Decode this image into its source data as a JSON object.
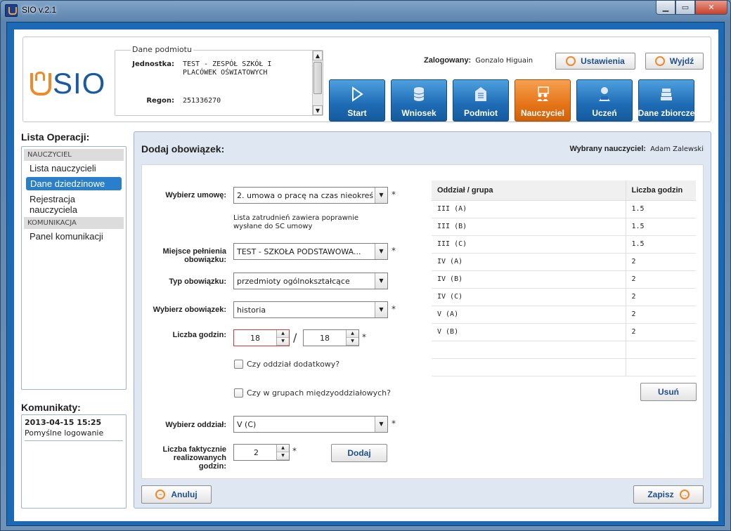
{
  "window": {
    "title": "SIO v.2.1"
  },
  "logo": {
    "text": "SIO"
  },
  "entity": {
    "legend": "Dane podmiotu",
    "name_label": "Jednostka:",
    "name_value": "TEST - ZESPÓŁ SZKÓŁ I PLACÓWEK OŚWIATOWYCH",
    "regon_label": "Regon:",
    "regon_value": "251336270"
  },
  "user": {
    "label": "Zalogowany:",
    "name": "Gonzalo Higuain"
  },
  "header_buttons": {
    "settings": "Ustawienia",
    "logout": "Wyjdź"
  },
  "nav": [
    {
      "label": "Start",
      "icon": "play-icon"
    },
    {
      "label": "Wniosek",
      "icon": "database-icon"
    },
    {
      "label": "Podmiot",
      "icon": "building-icon"
    },
    {
      "label": "Nauczyciel",
      "icon": "teacher-icon",
      "active": true
    },
    {
      "label": "Uczeń",
      "icon": "student-icon"
    },
    {
      "label": "Dane zbiorcze",
      "icon": "books-icon"
    }
  ],
  "sidebar": {
    "title": "Lista Operacji:",
    "section1": "NAUCZYCIEL",
    "items1": [
      "Lista nauczycieli",
      "Dane dziedzinowe",
      "Rejestracja nauczyciela"
    ],
    "selected": "Dane dziedzinowe",
    "section2": "KOMUNIKACJA",
    "items2": [
      "Panel komunikacji"
    ]
  },
  "messages": {
    "title": "Komunikaty:",
    "date": "2013-04-15 15:25",
    "text": "Pomyślne logowanie"
  },
  "main": {
    "title": "Dodaj obowiązek:",
    "teacher_label": "Wybrany nauczyciel:",
    "teacher_name": "Adam Zalewski"
  },
  "form": {
    "contract_label": "Wybierz umowę:",
    "contract_value": "2. umowa o pracę na czas nieokreś",
    "contract_note": "Lista zatrudnień zawiera poprawnie wysłane do SC umowy",
    "place_label": "Miejsce pełnienia obowiązku:",
    "place_value": "TEST - SZKOŁA PODSTAWOWA...",
    "type_label": "Typ obowiązku:",
    "type_value": "przedmioty ogólnokształcące",
    "duty_label": "Wybierz obowiązek:",
    "duty_value": "historia",
    "hours_label": "Liczba godzin:",
    "hours_a": "18",
    "hours_separator": "/",
    "hours_b": "18",
    "extra_class_label": "Czy oddział dodatkowy?",
    "inter_group_label": "Czy w grupach międzyoddziałowych?",
    "class_label": "Wybierz oddział:",
    "class_value": "V (C)",
    "actual_hours_label": "Liczba faktycznie realizowanych godzin:",
    "actual_hours_value": "2",
    "add_button": "Dodaj",
    "required_mark": "*"
  },
  "table": {
    "headers": [
      "Oddział / grupa",
      "Liczba godzin"
    ],
    "rows": [
      [
        "III (A)",
        "1.5"
      ],
      [
        "III (B)",
        "1.5"
      ],
      [
        "III (C)",
        "1.5"
      ],
      [
        "IV (A)",
        "2"
      ],
      [
        "IV (B)",
        "2"
      ],
      [
        "IV (C)",
        "2"
      ],
      [
        "V (A)",
        "2"
      ],
      [
        "V (B)",
        "2"
      ],
      [
        "",
        ""
      ],
      [
        "",
        ""
      ]
    ],
    "remove_button": "Usuń"
  },
  "footer": {
    "cancel": "Anuluj",
    "save": "Zapisz"
  },
  "colors": {
    "accent_blue": "#1c6ab5",
    "accent_orange": "#e57418",
    "selected_item": "#2a7fcb"
  }
}
